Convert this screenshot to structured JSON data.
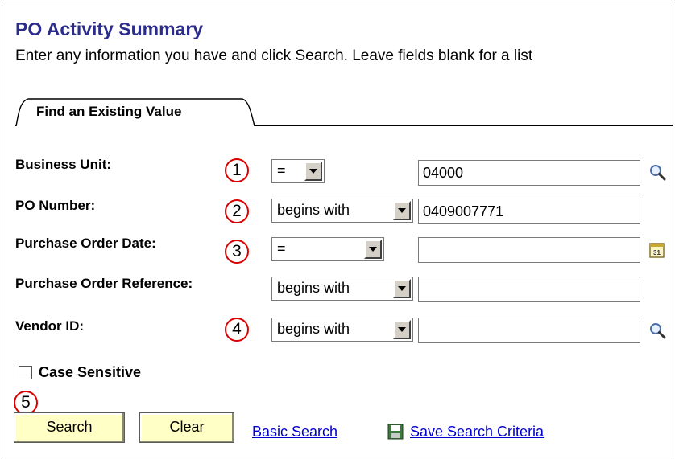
{
  "page": {
    "title": "PO Activity Summary",
    "instructions": "Enter any information you have and click Search. Leave fields blank for a list"
  },
  "tabs": [
    {
      "label": "Find an Existing Value",
      "active": true
    }
  ],
  "fields": [
    {
      "label": "Business Unit:",
      "callout": "1",
      "operator": "=",
      "value": "04000",
      "trailing_icon": "lookup-icon"
    },
    {
      "label": "PO Number:",
      "callout": "2",
      "operator": "begins with",
      "value": "0409007771",
      "trailing_icon": ""
    },
    {
      "label": "Purchase Order Date:",
      "callout": "3",
      "operator": "=",
      "value": "",
      "trailing_icon": "calendar-icon"
    },
    {
      "label": "Purchase Order Reference:",
      "callout": "",
      "operator": "begins with",
      "value": "",
      "trailing_icon": ""
    },
    {
      "label": "Vendor ID:",
      "callout": "4",
      "operator": "begins with",
      "value": "",
      "trailing_icon": "lookup-icon"
    }
  ],
  "case_sensitive": {
    "label": "Case Sensitive",
    "checked": false
  },
  "actions": {
    "callout": "5",
    "search_label": "Search",
    "clear_label": "Clear",
    "basic_search_label": "Basic Search",
    "save_criteria_label": "Save Search Criteria",
    "save_icon": "save-icon"
  },
  "colors": {
    "title": "#2c2c8a",
    "callout_ring": "#d90000",
    "button_bg": "#ffffc6",
    "link": "#0000cc"
  }
}
